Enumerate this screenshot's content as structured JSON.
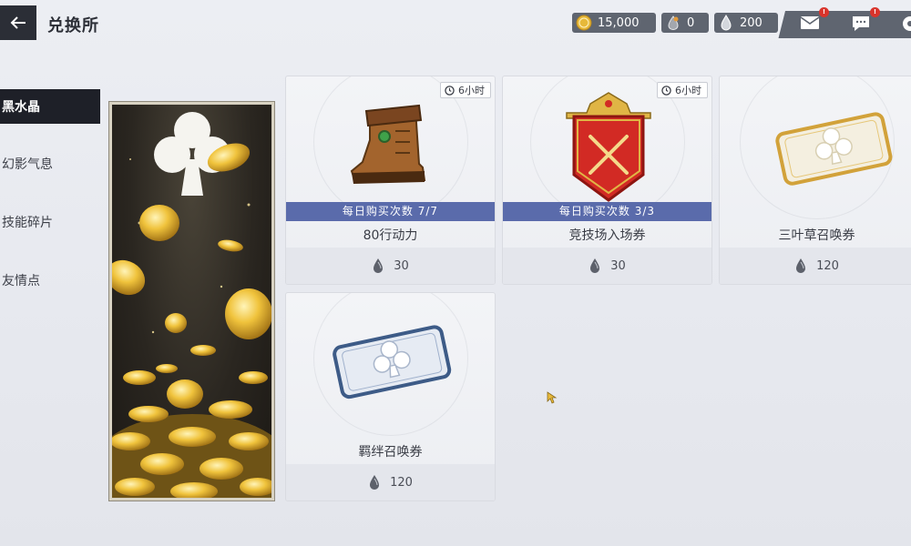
{
  "header": {
    "title": "兑换所",
    "back_icon": "back-arrow-icon"
  },
  "currencies": [
    {
      "name": "gold-coin",
      "icon": "gold-coin-icon",
      "value": "15,000",
      "color": "#e7b93a"
    },
    {
      "name": "stone",
      "icon": "stone-icon",
      "value": "0",
      "color": "#8b8f98"
    },
    {
      "name": "crystal",
      "icon": "black-crystal-icon",
      "value": "200",
      "color": "#9aa0ab"
    }
  ],
  "notifications": [
    {
      "icon": "mail-icon",
      "badge": "!"
    },
    {
      "icon": "chat-icon",
      "badge": "!"
    },
    {
      "icon": "settings-icon",
      "badge": ""
    }
  ],
  "sidebar": {
    "items": [
      {
        "label": "黑水晶",
        "active": true
      },
      {
        "label": "幻影气息",
        "active": false
      },
      {
        "label": "技能碎片",
        "active": false
      },
      {
        "label": "友情点",
        "active": false
      }
    ]
  },
  "shop": {
    "items": [
      {
        "name": "80行动力",
        "limit": "每日购买次数 7/7",
        "timer": "6小时",
        "price": "30",
        "art": "boot-icon"
      },
      {
        "name": "竞技场入场券",
        "limit": "每日购买次数 3/3",
        "timer": "6小时",
        "price": "30",
        "art": "arena-shield-icon"
      },
      {
        "name": "三叶草召唤券",
        "limit": "",
        "timer": "",
        "price": "120",
        "art": "gold-clover-ticket-icon"
      },
      {
        "name": "羁绊召唤券",
        "limit": "",
        "timer": "",
        "price": "120",
        "art": "silver-clover-ticket-icon"
      }
    ]
  },
  "colors": {
    "accent_blue": "#5a6bab",
    "dark": "#1e2028",
    "gold": "#e7b93a"
  }
}
